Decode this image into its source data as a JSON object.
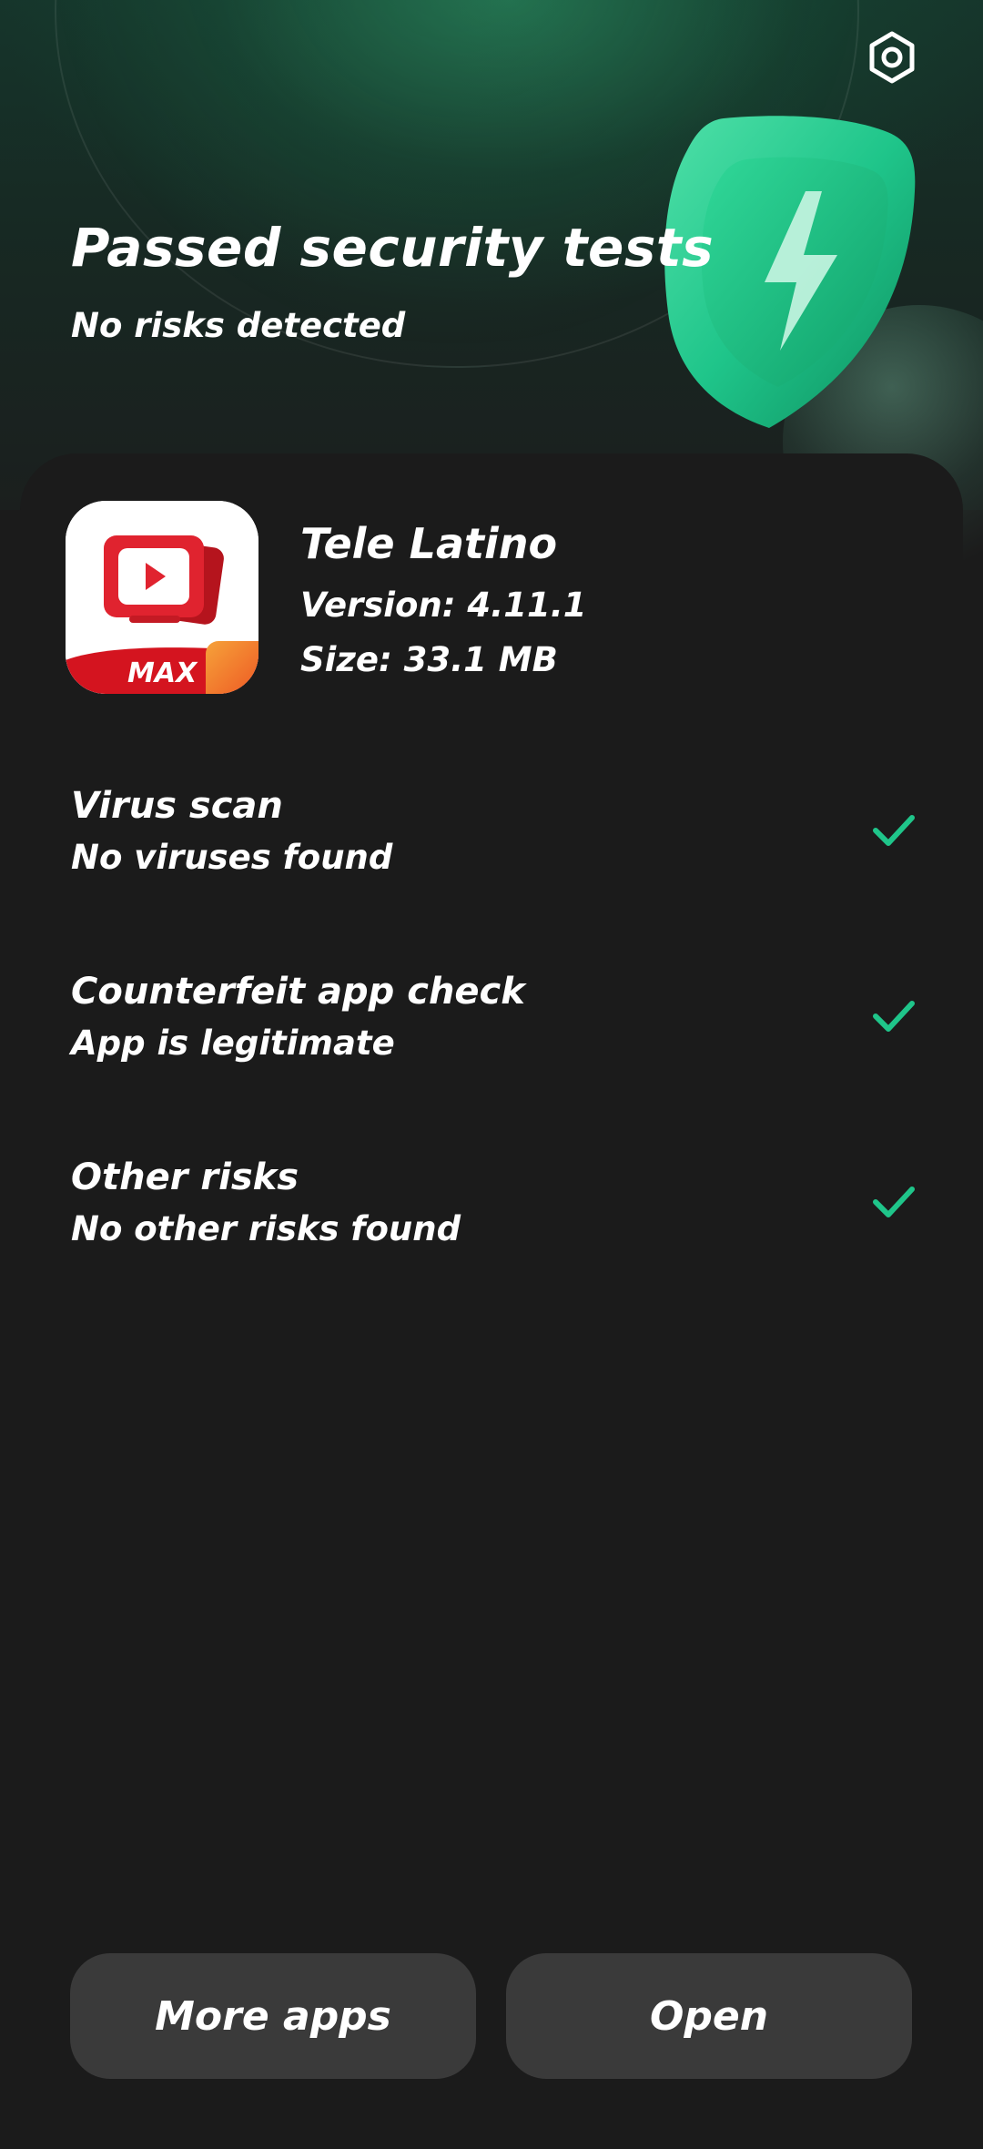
{
  "header": {
    "title": "Passed security tests",
    "subtitle": "No risks detected",
    "settings_icon": "settings-hexagon-icon",
    "shield_icon": "shield-lightning-icon"
  },
  "app": {
    "name": "Tele Latino",
    "version": "Version: 4.11.1",
    "size": "Size: 33.1 MB",
    "icon_badge_text": "MAX"
  },
  "checks": [
    {
      "title": "Virus scan",
      "description": "No viruses found",
      "status_icon": "checkmark-icon"
    },
    {
      "title": "Counterfeit app check",
      "description": "App is legitimate",
      "status_icon": "checkmark-icon"
    },
    {
      "title": "Other risks",
      "description": "No other risks found",
      "status_icon": "checkmark-icon"
    }
  ],
  "actions": {
    "more_apps_label": "More apps",
    "open_label": "Open"
  },
  "colors": {
    "accent_green": "#1fc58a",
    "background": "#1b1b1b",
    "button_bg": "#3a3a3a",
    "app_icon_red": "#e0232f"
  }
}
